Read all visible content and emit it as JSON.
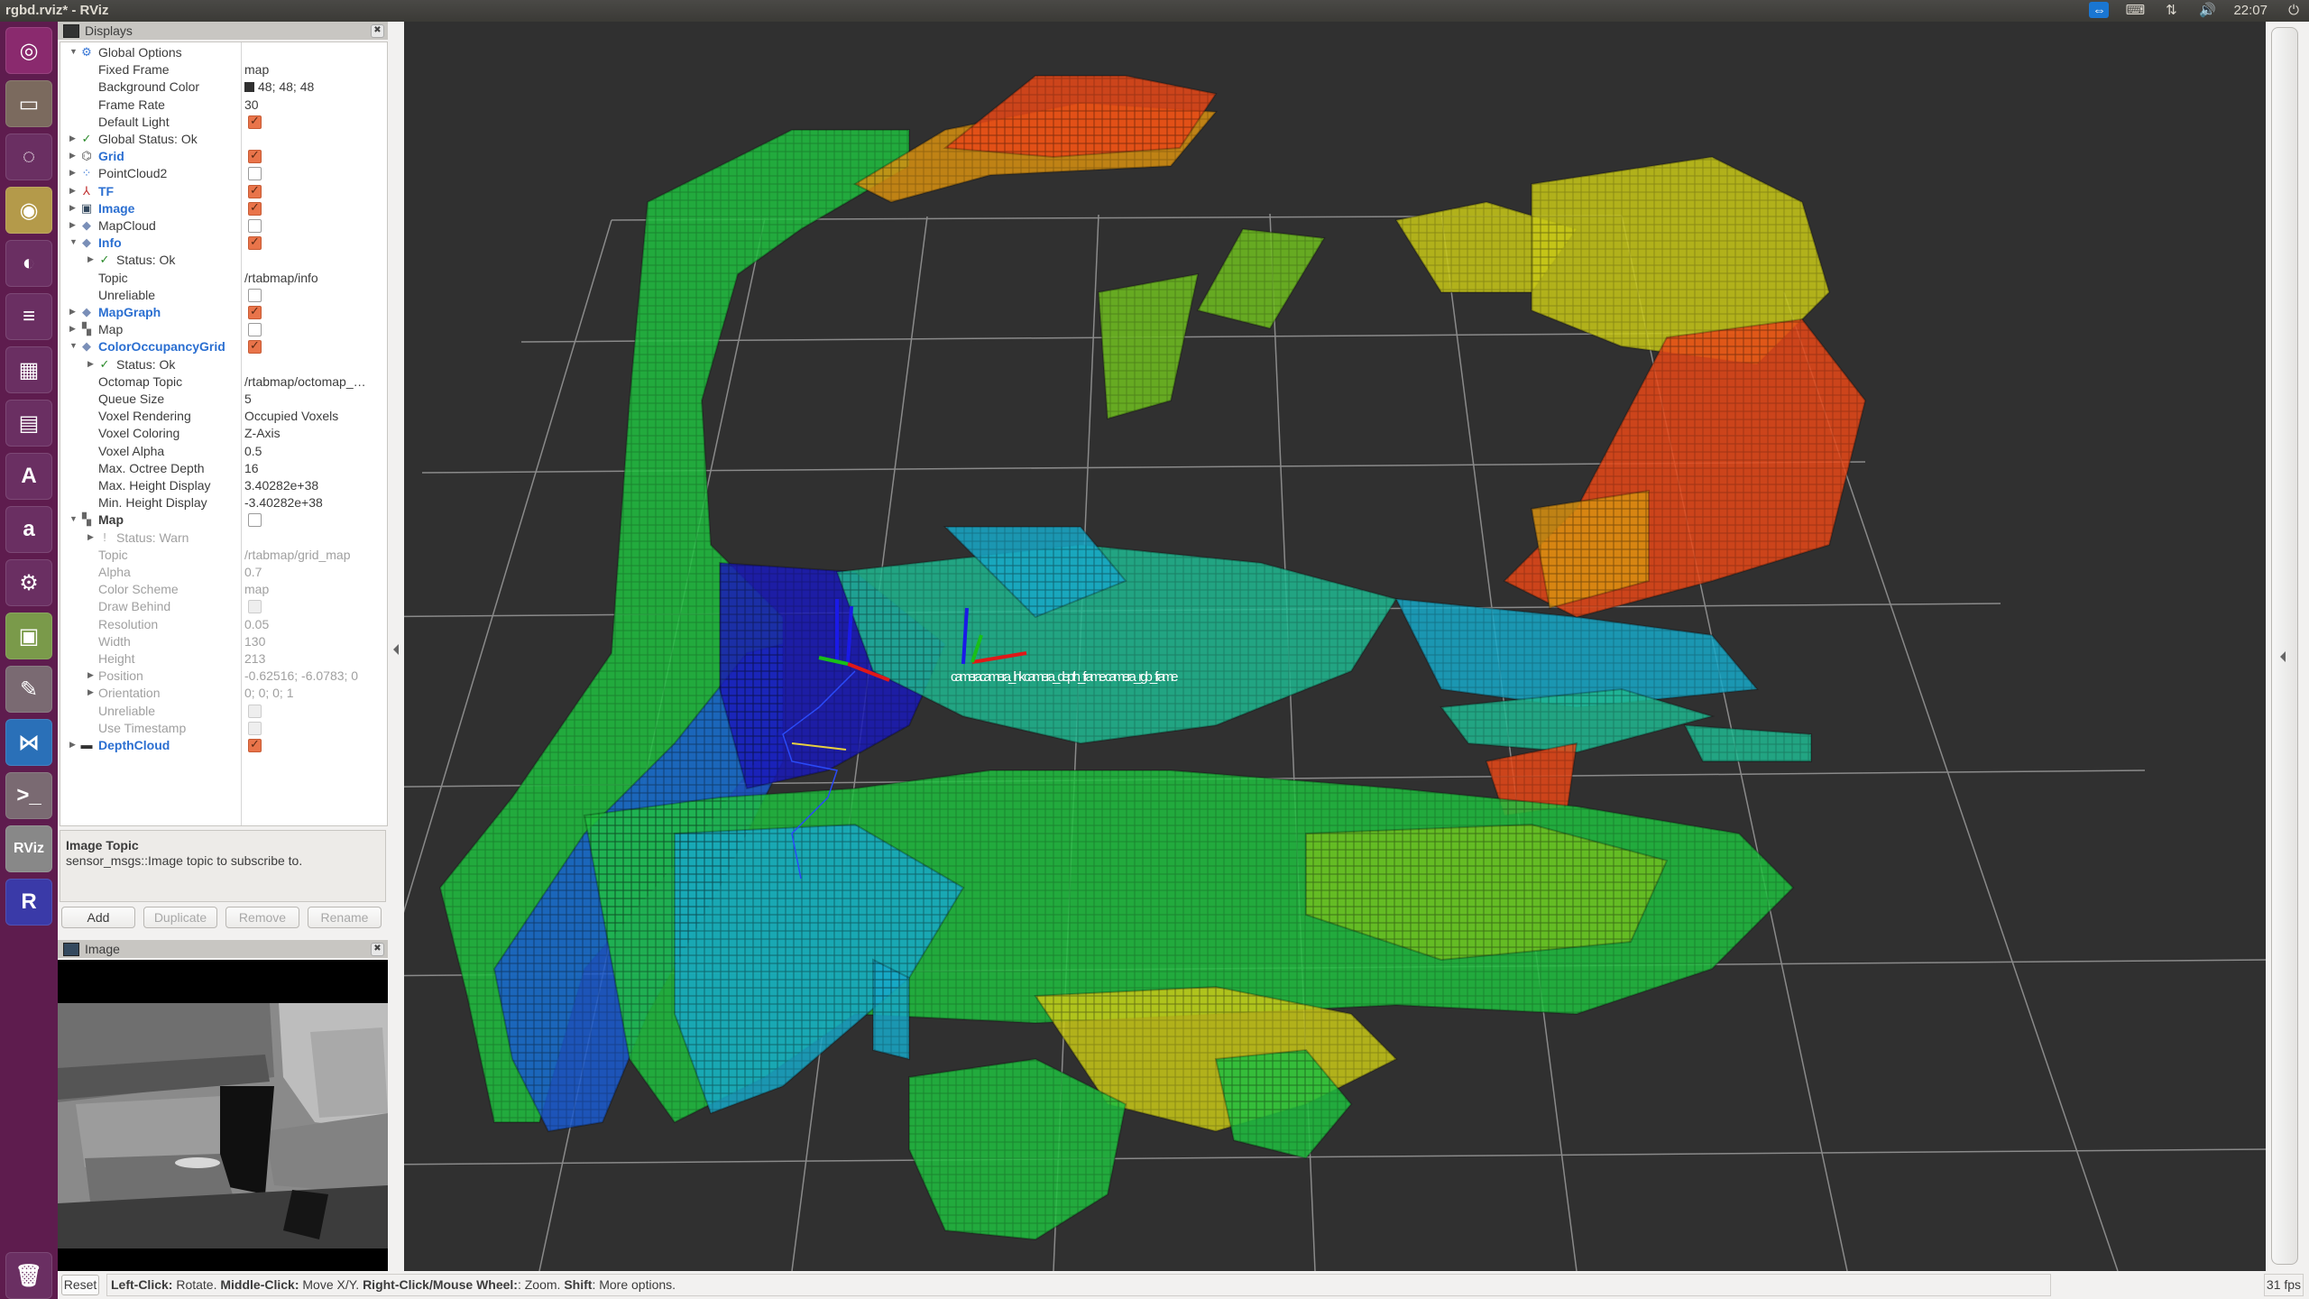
{
  "window": {
    "title": "rgbd.rviz* - RViz"
  },
  "tray": {
    "time": "22:07",
    "icons": [
      "teamviewer-icon",
      "keyboard-icon",
      "network-icon",
      "volume-icon",
      "power-icon"
    ]
  },
  "launcher": {
    "apps": [
      {
        "name": "ubuntu-dash",
        "glyph": "◎",
        "color": "#8a2a6e"
      },
      {
        "name": "files",
        "glyph": "▭",
        "color": "#7b6a5e"
      },
      {
        "name": "chat-app",
        "glyph": "◌",
        "color": "#6a2f62"
      },
      {
        "name": "chrome",
        "glyph": "◉",
        "color": "#b49a4a"
      },
      {
        "name": "firefox",
        "glyph": "◐",
        "color": "#6a2f62"
      },
      {
        "name": "libreoffice-writer",
        "glyph": "≡",
        "color": "#6a2f62"
      },
      {
        "name": "libreoffice-calc",
        "glyph": "▦",
        "color": "#6a2f62"
      },
      {
        "name": "libreoffice-impress",
        "glyph": "▤",
        "color": "#6a2f62"
      },
      {
        "name": "software-center",
        "glyph": "A",
        "color": "#6a2f62"
      },
      {
        "name": "amazon",
        "glyph": "a",
        "color": "#6a2f62"
      },
      {
        "name": "system-settings",
        "glyph": "⚙",
        "color": "#6a2f62"
      },
      {
        "name": "vmware",
        "glyph": "▣",
        "color": "#7a9a4a"
      },
      {
        "name": "text-editor",
        "glyph": "✎",
        "color": "#7a6a72"
      },
      {
        "name": "vscode",
        "glyph": "⋈",
        "color": "#2a70b8"
      },
      {
        "name": "terminal",
        "glyph": ">_",
        "color": "#7a6a72"
      },
      {
        "name": "rviz",
        "glyph": "RViz",
        "color": "#888"
      },
      {
        "name": "rtabmap",
        "glyph": "R",
        "color": "#3a3aa8"
      },
      {
        "name": "trash",
        "glyph": "🗑",
        "color": "#6a2f62"
      }
    ]
  },
  "displays": {
    "title": "Displays",
    "rows": [
      {
        "indent": 0,
        "arrow": "▼",
        "icon": "⚙",
        "icon_name": "gear-icon",
        "icon_color": "#3a78d6",
        "label": "Global Options",
        "style": "",
        "value": "",
        "check": null
      },
      {
        "indent": 1,
        "arrow": "",
        "icon": "",
        "label": "Fixed Frame",
        "style": "",
        "value": "map",
        "check": null
      },
      {
        "indent": 1,
        "arrow": "",
        "icon": "",
        "label": "Background Color",
        "style": "",
        "value": "48; 48; 48",
        "swatch": true,
        "check": null
      },
      {
        "indent": 1,
        "arrow": "",
        "icon": "",
        "label": "Frame Rate",
        "style": "",
        "value": "30",
        "check": null
      },
      {
        "indent": 1,
        "arrow": "",
        "icon": "",
        "label": "Default Light",
        "style": "",
        "value": "",
        "check": "on"
      },
      {
        "indent": 0,
        "arrow": "▶",
        "icon": "✓",
        "icon_name": "check-icon",
        "icon_color": "#2a8a2a",
        "label": "Global Status: Ok",
        "style": "",
        "value": "",
        "check": null
      },
      {
        "indent": 0,
        "arrow": "▶",
        "icon": "⌬",
        "icon_name": "grid-icon",
        "icon_color": "#555",
        "label": "Grid",
        "style": "blue",
        "value": "",
        "check": "on"
      },
      {
        "indent": 0,
        "arrow": "▶",
        "icon": "⁘",
        "icon_name": "pointcloud-icon",
        "icon_color": "#3a78d6",
        "label": "PointCloud2",
        "style": "",
        "value": "",
        "check": "off"
      },
      {
        "indent": 0,
        "arrow": "▶",
        "icon": "⅄",
        "icon_name": "tf-axes-icon",
        "icon_color": "#c03030",
        "label": "TF",
        "style": "blue",
        "value": "",
        "check": "on"
      },
      {
        "indent": 0,
        "arrow": "▶",
        "icon": "▣",
        "icon_name": "image-icon",
        "icon_color": "#34495e",
        "label": "Image",
        "style": "blue",
        "value": "",
        "check": "on"
      },
      {
        "indent": 0,
        "arrow": "▶",
        "icon": "◆",
        "icon_name": "plugin-icon",
        "icon_color": "#7a8fb8",
        "label": "MapCloud",
        "style": "",
        "value": "",
        "check": "off"
      },
      {
        "indent": 0,
        "arrow": "▼",
        "icon": "◆",
        "icon_name": "plugin-icon",
        "icon_color": "#7a8fb8",
        "label": "Info",
        "style": "blue",
        "value": "",
        "check": "on"
      },
      {
        "indent": 1,
        "arrow": "▶",
        "icon": "✓",
        "icon_name": "check-icon",
        "icon_color": "#2a8a2a",
        "label": "Status: Ok",
        "style": "",
        "value": "",
        "check": null
      },
      {
        "indent": 1,
        "arrow": "",
        "icon": "",
        "label": "Topic",
        "style": "",
        "value": "/rtabmap/info",
        "check": null
      },
      {
        "indent": 1,
        "arrow": "",
        "icon": "",
        "label": "Unreliable",
        "style": "",
        "value": "",
        "check": "off"
      },
      {
        "indent": 0,
        "arrow": "▶",
        "icon": "◆",
        "icon_name": "plugin-icon",
        "icon_color": "#7a8fb8",
        "label": "MapGraph",
        "style": "blue",
        "value": "",
        "check": "on"
      },
      {
        "indent": 0,
        "arrow": "▶",
        "icon": "▚",
        "icon_name": "map-icon",
        "icon_color": "#666",
        "label": "Map",
        "style": "",
        "value": "",
        "check": "off"
      },
      {
        "indent": 0,
        "arrow": "▼",
        "icon": "◆",
        "icon_name": "plugin-icon",
        "icon_color": "#7a8fb8",
        "label": "ColorOccupancyGrid",
        "style": "blue",
        "value": "",
        "check": "on"
      },
      {
        "indent": 1,
        "arrow": "▶",
        "icon": "✓",
        "icon_name": "check-icon",
        "icon_color": "#2a8a2a",
        "label": "Status: Ok",
        "style": "",
        "value": "",
        "check": null
      },
      {
        "indent": 1,
        "arrow": "",
        "icon": "",
        "label": "Octomap Topic",
        "style": "",
        "value": "/rtabmap/octomap_…",
        "check": null
      },
      {
        "indent": 1,
        "arrow": "",
        "icon": "",
        "label": "Queue Size",
        "style": "",
        "value": "5",
        "check": null
      },
      {
        "indent": 1,
        "arrow": "",
        "icon": "",
        "label": "Voxel Rendering",
        "style": "",
        "value": "Occupied Voxels",
        "check": null
      },
      {
        "indent": 1,
        "arrow": "",
        "icon": "",
        "label": "Voxel Coloring",
        "style": "",
        "value": "Z-Axis",
        "check": null
      },
      {
        "indent": 1,
        "arrow": "",
        "icon": "",
        "label": "Voxel Alpha",
        "style": "",
        "value": "0.5",
        "check": null
      },
      {
        "indent": 1,
        "arrow": "",
        "icon": "",
        "label": "Max. Octree Depth",
        "style": "",
        "value": "16",
        "check": null
      },
      {
        "indent": 1,
        "arrow": "",
        "icon": "",
        "label": "Max. Height Display",
        "style": "",
        "value": "3.40282e+38",
        "check": null
      },
      {
        "indent": 1,
        "arrow": "",
        "icon": "",
        "label": "Min. Height Display",
        "style": "",
        "value": "-3.40282e+38",
        "check": null
      },
      {
        "indent": 0,
        "arrow": "▼",
        "icon": "▚",
        "icon_name": "map-icon",
        "icon_color": "#666",
        "label": "Map",
        "style": "bold",
        "value": "",
        "check": "off"
      },
      {
        "indent": 1,
        "arrow": "▶",
        "icon": "!",
        "icon_name": "warning-icon",
        "icon_color": "#aaa",
        "label": "Status: Warn",
        "style": "dis",
        "value": "",
        "check": null
      },
      {
        "indent": 1,
        "arrow": "",
        "icon": "",
        "label": "Topic",
        "style": "dis",
        "value": "/rtabmap/grid_map",
        "check": null
      },
      {
        "indent": 1,
        "arrow": "",
        "icon": "",
        "label": "Alpha",
        "style": "dis",
        "value": "0.7",
        "check": null
      },
      {
        "indent": 1,
        "arrow": "",
        "icon": "",
        "label": "Color Scheme",
        "style": "dis",
        "value": "map",
        "check": null
      },
      {
        "indent": 1,
        "arrow": "",
        "icon": "",
        "label": "Draw Behind",
        "style": "dis",
        "value": "",
        "check": "dis"
      },
      {
        "indent": 1,
        "arrow": "",
        "icon": "",
        "label": "Resolution",
        "style": "dis",
        "value": "0.05",
        "check": null
      },
      {
        "indent": 1,
        "arrow": "",
        "icon": "",
        "label": "Width",
        "style": "dis",
        "value": "130",
        "check": null
      },
      {
        "indent": 1,
        "arrow": "",
        "icon": "",
        "label": "Height",
        "style": "dis",
        "value": "213",
        "check": null
      },
      {
        "indent": 1,
        "arrow": "▶",
        "icon": "",
        "label": "Position",
        "style": "dis",
        "value": "-0.62516; -6.0783; 0",
        "check": null
      },
      {
        "indent": 1,
        "arrow": "▶",
        "icon": "",
        "label": "Orientation",
        "style": "dis",
        "value": "0; 0; 0; 1",
        "check": null
      },
      {
        "indent": 1,
        "arrow": "",
        "icon": "",
        "label": "Unreliable",
        "style": "dis",
        "value": "",
        "check": "dis"
      },
      {
        "indent": 1,
        "arrow": "",
        "icon": "",
        "label": "Use Timestamp",
        "style": "dis",
        "value": "",
        "check": "dis"
      },
      {
        "indent": 0,
        "arrow": "▶",
        "icon": "▬",
        "icon_name": "depthcloud-icon",
        "icon_color": "#333",
        "label": "DepthCloud",
        "style": "blue",
        "value": "",
        "check": "on"
      }
    ],
    "description": {
      "heading": "Image Topic",
      "text": "sensor_msgs::Image topic to subscribe to."
    },
    "buttons": {
      "add": "Add",
      "duplicate": "Duplicate",
      "remove": "Remove",
      "rename": "Rename"
    }
  },
  "image_panel": {
    "title": "Image"
  },
  "viewport": {
    "tf_label": "cameracamera_link camera_depth_frame camera_rgb_frame",
    "background": "#303030",
    "colormap": [
      "#1a1ab8",
      "#1a5ad0",
      "#18a8c8",
      "#20b890",
      "#20c040",
      "#70c020",
      "#c8c818",
      "#d89010",
      "#e84818"
    ]
  },
  "status_bar": {
    "reset": "Reset",
    "hint": [
      {
        "b": "Left-Click:",
        "t": " Rotate. "
      },
      {
        "b": "Middle-Click:",
        "t": " Move X/Y. "
      },
      {
        "b": "Right-Click/Mouse Wheel:",
        "t": ": Zoom. "
      },
      {
        "b": "Shift",
        "t": ": More options."
      }
    ],
    "fps": "31 fps"
  }
}
